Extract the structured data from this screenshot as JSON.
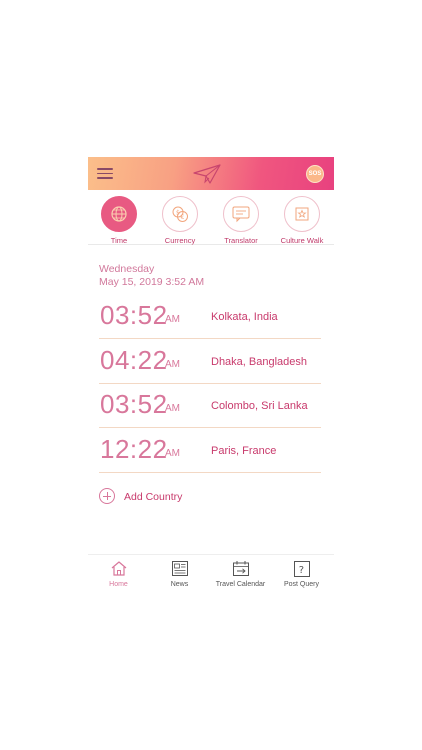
{
  "header": {
    "sos_label": "SOS"
  },
  "tabs": [
    {
      "label": "Time",
      "icon": "globe-icon",
      "active": true
    },
    {
      "label": "Currency",
      "icon": "currency-exchange-icon",
      "active": false
    },
    {
      "label": "Translator",
      "icon": "translator-icon",
      "active": false
    },
    {
      "label": "Culture Walk",
      "icon": "culture-walk-icon",
      "active": false
    }
  ],
  "date": {
    "weekday": "Wednesday",
    "full": "May 15, 2019 3:52 AM"
  },
  "clocks": [
    {
      "time": "03:52",
      "ampm": "AM",
      "city": "Kolkata, India"
    },
    {
      "time": "04:22",
      "ampm": "AM",
      "city": "Dhaka, Bangladesh"
    },
    {
      "time": "03:52",
      "ampm": "AM",
      "city": "Colombo, Sri Lanka"
    },
    {
      "time": "12:22",
      "ampm": "AM",
      "city": "Paris, France"
    }
  ],
  "add_country": {
    "label": "Add Country"
  },
  "bottom_nav": [
    {
      "label": "Home",
      "icon": "home-icon",
      "active": true
    },
    {
      "label": "News",
      "icon": "news-icon",
      "active": false
    },
    {
      "label": "Travel Calendar",
      "icon": "calendar-icon",
      "active": false
    },
    {
      "label": "Post Query",
      "icon": "question-icon",
      "active": false
    }
  ],
  "colors": {
    "accent": "#e85a82",
    "text_pink": "#c83a6c",
    "light_pink": "#d8779b",
    "header_start": "#fbbf8a",
    "header_end": "#e8417f"
  }
}
